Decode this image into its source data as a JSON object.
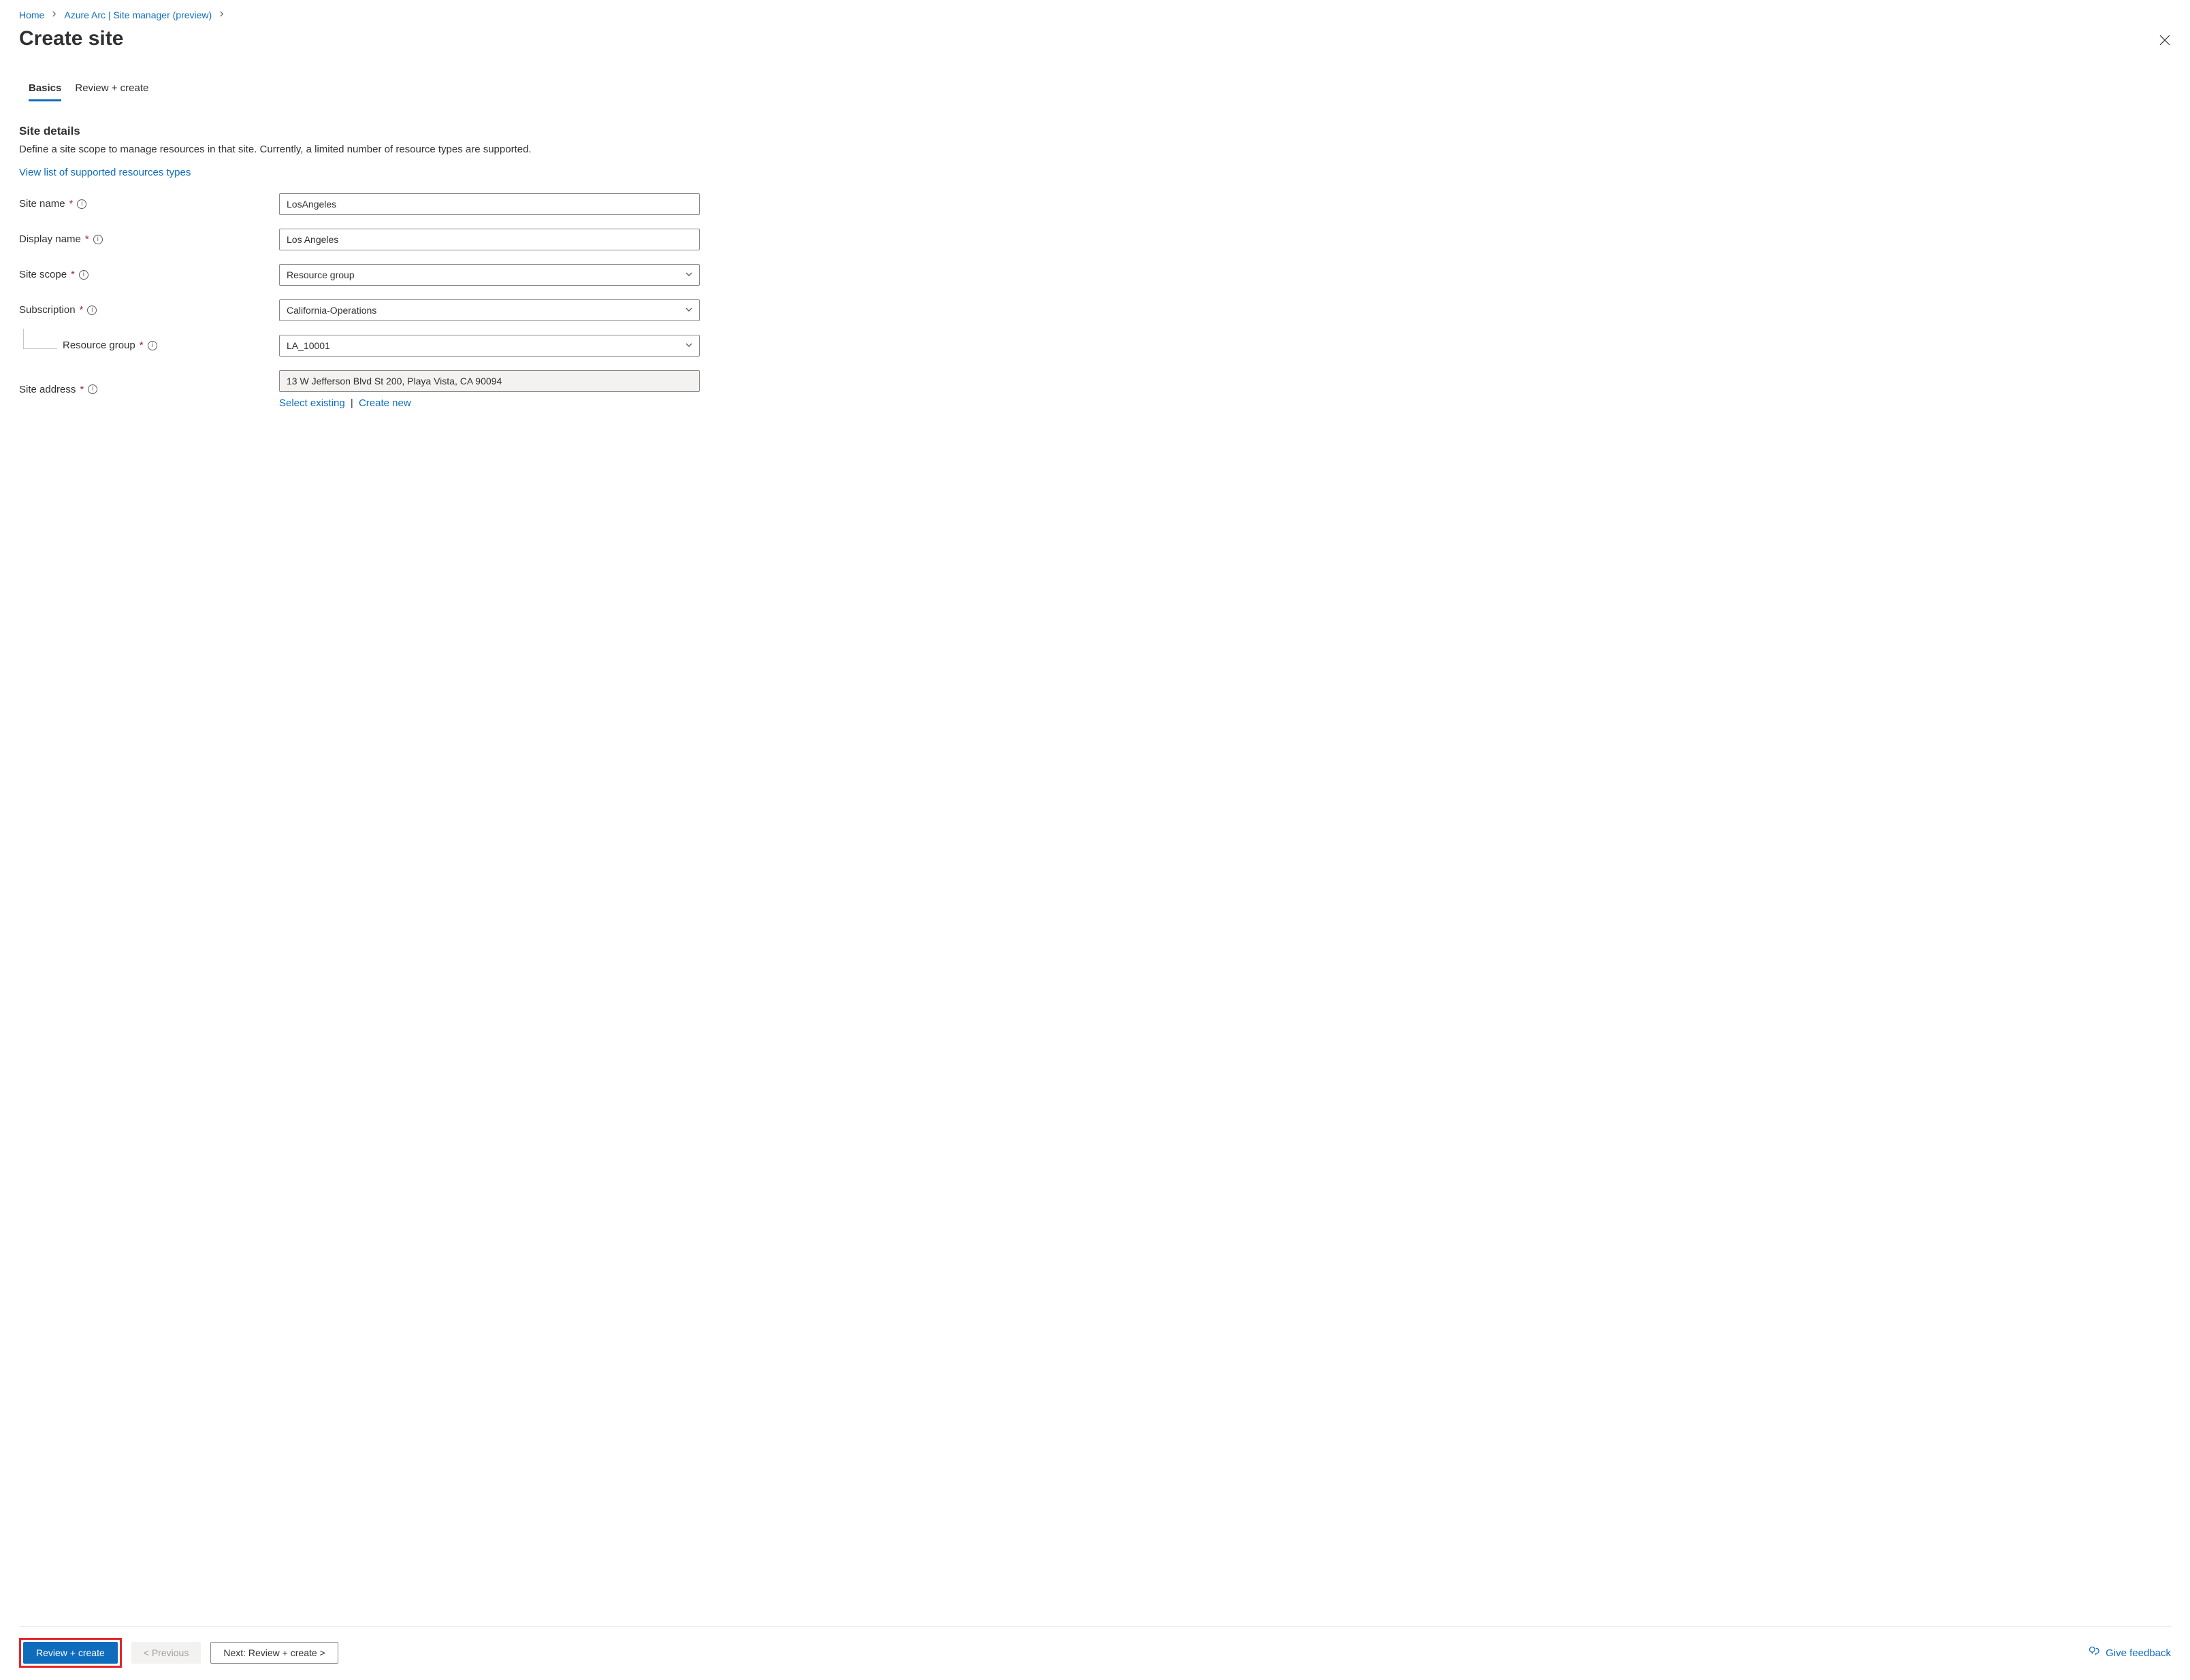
{
  "breadcrumb": {
    "items": [
      "Home",
      "Azure Arc | Site manager (preview)"
    ]
  },
  "header": {
    "title": "Create site"
  },
  "tabs": {
    "items": [
      "Basics",
      "Review + create"
    ],
    "active_index": 0
  },
  "section": {
    "title": "Site details",
    "description": "Define a site scope to manage resources in that site. Currently, a limited number of resource types are supported.",
    "supported_link": "View list of supported resources types"
  },
  "form": {
    "site_name": {
      "label": "Site name",
      "value": "LosAngeles"
    },
    "display_name": {
      "label": "Display name",
      "value": "Los Angeles"
    },
    "site_scope": {
      "label": "Site scope",
      "value": "Resource group"
    },
    "subscription": {
      "label": "Subscription",
      "value": "California-Operations"
    },
    "resource_group": {
      "label": "Resource group",
      "value": "LA_10001"
    },
    "site_address": {
      "label": "Site address",
      "value": "13 W Jefferson Blvd St 200, Playa Vista, CA 90094",
      "select_existing": "Select existing",
      "create_new": "Create new"
    }
  },
  "footer": {
    "review_create": "Review + create",
    "previous": "< Previous",
    "next": "Next: Review + create >",
    "feedback": "Give feedback"
  }
}
